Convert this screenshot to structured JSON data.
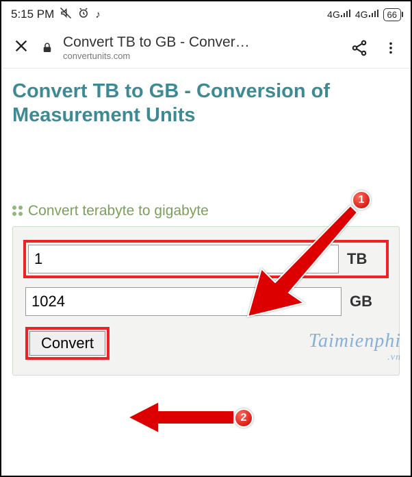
{
  "status": {
    "time": "5:15 PM",
    "mute_icon": "mute",
    "alarm_icon": "alarm",
    "tiktok_icon": "d",
    "net1": "4G",
    "net2": "4G",
    "battery": "66"
  },
  "browser": {
    "page_title": "Convert TB to GB - Conver…",
    "domain": "convertunits.com"
  },
  "page": {
    "heading": "Convert TB to GB - Conversion of Measurement Units",
    "section": "Convert terabyte to gigabyte"
  },
  "form": {
    "tb_value": "1",
    "tb_unit": "TB",
    "gb_value": "1024",
    "gb_unit": "GB",
    "convert_label": "Convert"
  },
  "annotations": {
    "marker1": "1",
    "marker2": "2"
  },
  "watermark": {
    "main": "Taimienphi",
    "suffix": ".vn"
  }
}
